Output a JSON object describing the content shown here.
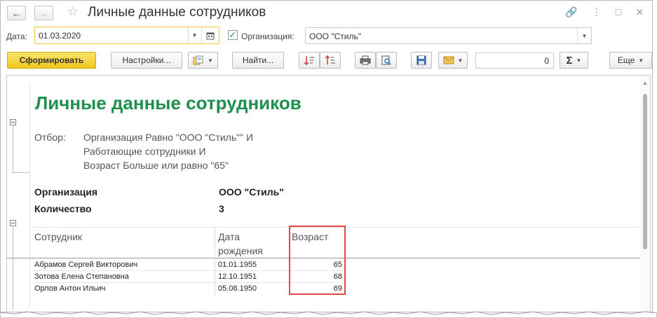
{
  "window": {
    "title": "Личные данные сотрудников"
  },
  "params": {
    "date_label": "Дата:",
    "date_value": "01.03.2020",
    "org_label": "Организация:",
    "org_checked": true,
    "org_value": "ООО \"Стиль\""
  },
  "toolbar": {
    "generate_label": "Сформировать",
    "settings_label": "Настройки...",
    "find_label": "Найти...",
    "sum_value": "0",
    "more_label": "Еще"
  },
  "report": {
    "title": "Личные данные сотрудников",
    "filter_label": "Отбор:",
    "filter_lines": [
      "Организация Равно \"ООО \"Стиль\"\" И",
      "Работающие сотрудники И",
      "Возраст Больше или равно \"65\""
    ],
    "org_param_label": "Организация",
    "org_param_value": "ООО \"Стиль\"",
    "count_label": "Количество",
    "count_value": "3",
    "columns": {
      "employee": "Сотрудник",
      "birth_date_line1": "Дата",
      "birth_date_line2": "рождения",
      "age": "Возраст"
    },
    "rows": [
      {
        "name": "Абрамов Сергей Викторович",
        "birth": "01.01.1955",
        "age": "65"
      },
      {
        "name": "Зотова Елена Степановна",
        "birth": "12.10.1951",
        "age": "68"
      },
      {
        "name": "Орлов Антон Ильич",
        "birth": "05.08.1950",
        "age": "69"
      }
    ]
  },
  "colors": {
    "report_title": "#1f8f4e",
    "primary_button": "#f1c71c",
    "highlight": "#e04a4a"
  }
}
